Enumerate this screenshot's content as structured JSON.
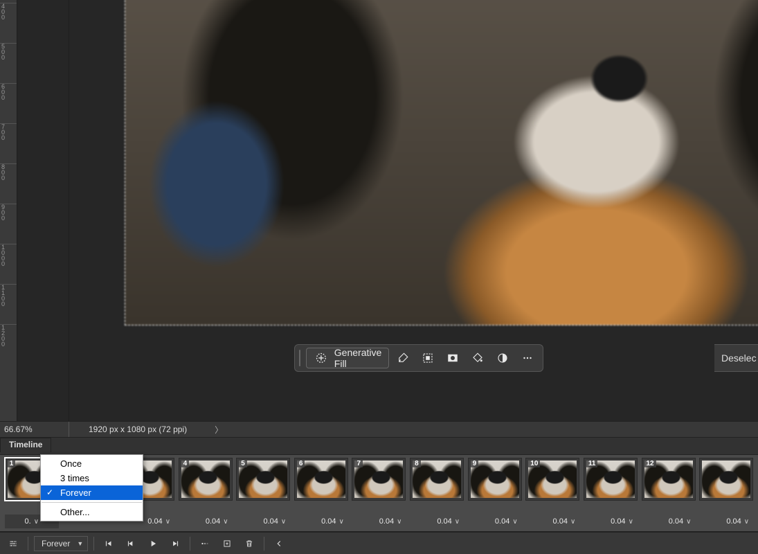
{
  "ruler_marks": [
    "400",
    "500",
    "600",
    "700",
    "800",
    "900",
    "1000",
    "1100",
    "1200"
  ],
  "status": {
    "zoom": "66.67%",
    "doc_info": "1920 px x 1080 px (72 ppi)"
  },
  "context_toolbar": {
    "generative_fill": "Generative Fill",
    "deselect": "Deselec"
  },
  "timeline": {
    "tab_label": "Timeline"
  },
  "loop_menu": {
    "once": "Once",
    "three_times": "3 times",
    "forever": "Forever",
    "other": "Other...",
    "selected": "Forever"
  },
  "frames": [
    {
      "num": "1",
      "delay": "0."
    },
    {
      "num": "",
      "delay": ""
    },
    {
      "num": "",
      "delay": "0.04"
    },
    {
      "num": "4",
      "delay": "0.04"
    },
    {
      "num": "5",
      "delay": "0.04"
    },
    {
      "num": "6",
      "delay": "0.04"
    },
    {
      "num": "7",
      "delay": "0.04"
    },
    {
      "num": "8",
      "delay": "0.04"
    },
    {
      "num": "9",
      "delay": "0.04"
    },
    {
      "num": "10",
      "delay": "0.04"
    },
    {
      "num": "11",
      "delay": "0.04"
    },
    {
      "num": "12",
      "delay": "0.04"
    },
    {
      "num": "",
      "delay": "0.04"
    }
  ],
  "playbar": {
    "loop_label": "Forever"
  }
}
